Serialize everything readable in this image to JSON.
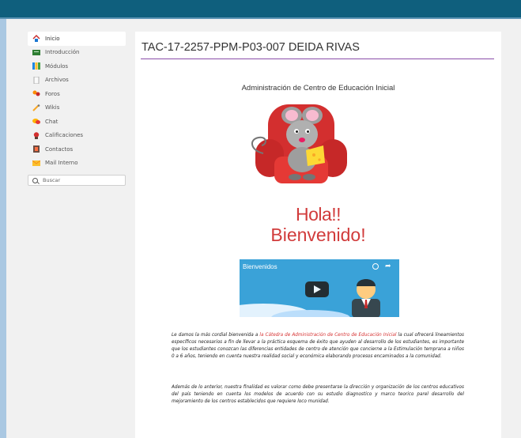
{
  "sidebar": {
    "items": [
      {
        "label": "Inicio",
        "icon": "home-icon"
      },
      {
        "label": "Introducción",
        "icon": "introduction-icon"
      },
      {
        "label": "Módulos",
        "icon": "modules-icon"
      },
      {
        "label": "Archivos",
        "icon": "files-icon"
      },
      {
        "label": "Foros",
        "icon": "forums-icon"
      },
      {
        "label": "Wikis",
        "icon": "wikis-icon"
      },
      {
        "label": "Chat",
        "icon": "chat-icon"
      },
      {
        "label": "Calificaciones",
        "icon": "grades-icon"
      },
      {
        "label": "Contactos",
        "icon": "contacts-icon"
      },
      {
        "label": "Mail Interno",
        "icon": "mail-icon"
      }
    ],
    "search_label": "Buscar"
  },
  "main": {
    "title": "TAC-17-2257-PPM-P03-007 DEIDA RIVAS",
    "subtitle": "Administración de Centro de Educación Inicial",
    "greeting_line1": "Hola!!",
    "greeting_line2": "Bienvenido!",
    "video_title": "Bienvenidos"
  },
  "paragraph1": {
    "before": "Le damos la más cordial bienvenida a ",
    "highlight": "la Cátedra de Administración de Centro de Educación Inicial",
    "after": " la cual ofrecerá lineamientos específicos necesarios a fin de llevar a la práctica esquema de éxito que ayuden al desarrollo de los estudiantes, es importante que los estudiantes conozcan las diferencias entidades de centro de atención que concierne a la Estimulación temprana a niños 0 a 6 años, teniendo en cuenta nuestra realidad social y económica elaborando procesos encaminados a la comunidad."
  },
  "paragraph2": "Además de lo anterior, nuestra finalidad es valorar como debe presentarse la dirección y organización de los centros educativos del país teniendo en cuenta los modelos de acuerdo con su estudio diagnostico y marco teorico parel desarrollo del mejoramiento de los centros establecidos que requiere loco munidad.",
  "colors": {
    "topbar": "#0f5f7d",
    "accent_rule": "#8a4da8",
    "greeting": "#d13b3b",
    "highlight": "#d63131"
  }
}
